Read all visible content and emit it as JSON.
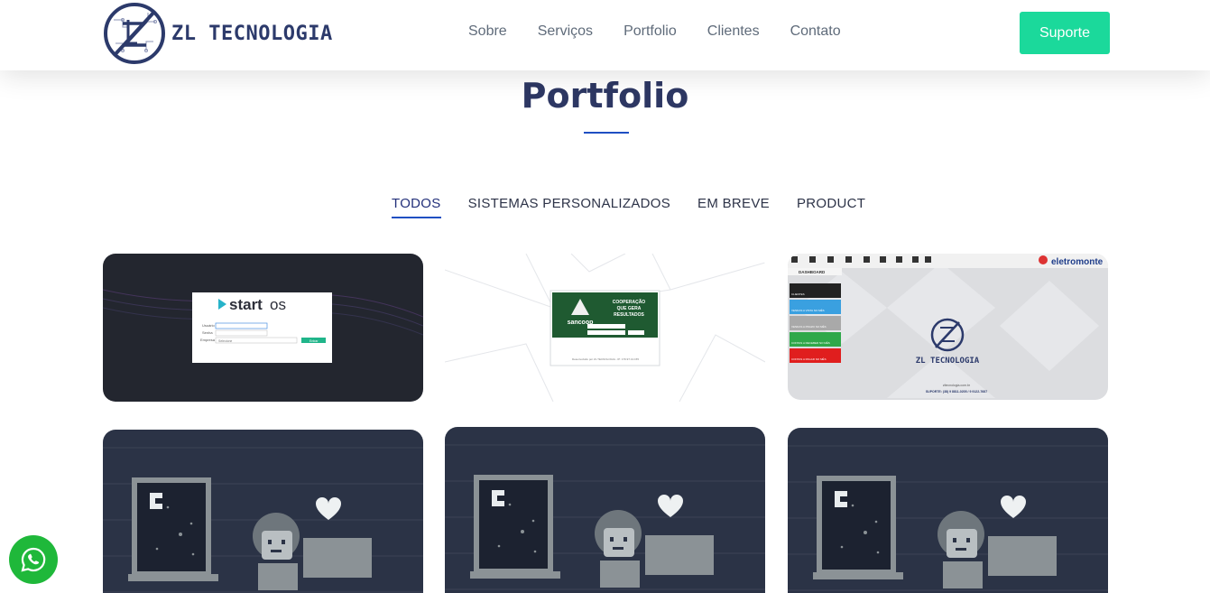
{
  "header": {
    "logo_text": "ZL TECNOLOGIA",
    "nav": [
      "Sobre",
      "Serviços",
      "Portfolio",
      "Clientes",
      "Contato"
    ],
    "support_label": "Suporte"
  },
  "section": {
    "title": "Portfolio",
    "filters": [
      "TODOS",
      "SISTEMAS PERSONALIZADOS",
      "EM BREVE",
      "PRODUCT"
    ],
    "active_filter": "TODOS"
  },
  "cards": [
    {
      "name": "start os",
      "login_labels": [
        "Usuário",
        "Senha",
        "Empresa"
      ],
      "select_value": "Selecione",
      "button": "Entrar"
    },
    {
      "name": "sancoop",
      "tagline": [
        "COOPERAÇÃO",
        "QUE GERA",
        "RESULTADOS"
      ],
      "footer": "Desenvolvido por ZL TECNOLOGIA - IP: 179.97.13.155"
    },
    {
      "name": "eletromonte",
      "dashboard_title": "DASHBOARD",
      "logo": "ZL TECNOLOGIA",
      "tiles": [
        "CLIENTES",
        "VENDAS A VISTA NO MÊS",
        "VENDAS A PRAZO NO MÊS",
        "CONTAS A RECEBER NO MÊS",
        "CONTAS A PAGAR NO MÊS"
      ],
      "site": "zltecnologia.com.br",
      "support": "SUPORTE: (38) 9 8811-0205 / 9 9122-7687"
    },
    {
      "name": "em-breve-1"
    },
    {
      "name": "em-breve-2"
    },
    {
      "name": "em-breve-3"
    }
  ],
  "colors": {
    "accent_green": "#1bd99b",
    "title_navy": "#2d3763",
    "underline_blue": "#1f4fc2",
    "card_dark": "#2b3346",
    "whatsapp_green": "#1fb83a"
  }
}
